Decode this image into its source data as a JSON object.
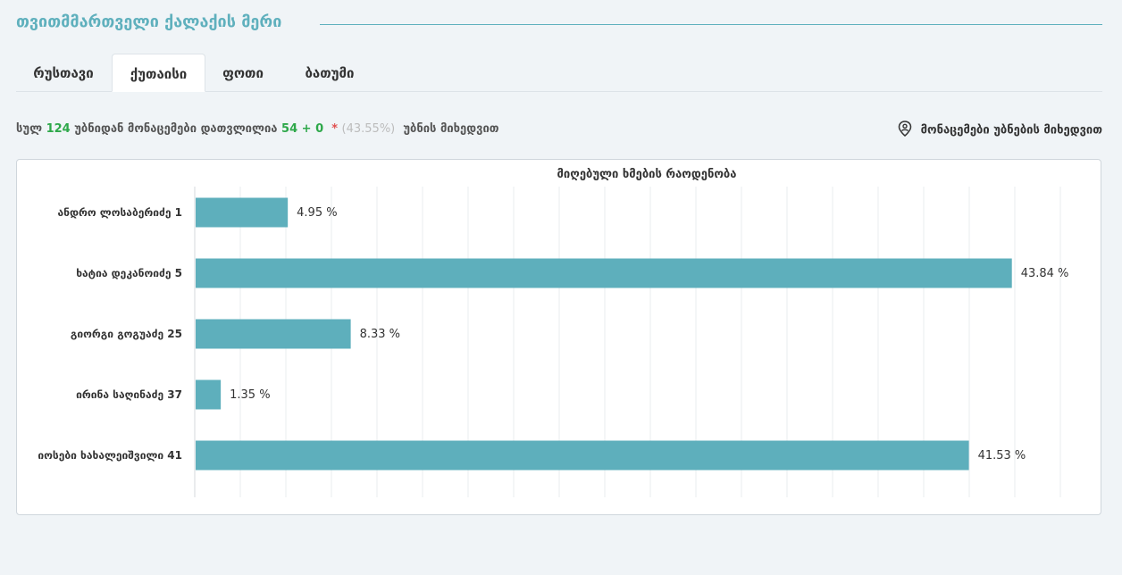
{
  "header": {
    "title": "თვითმმართველი ქალაქის მერი"
  },
  "tabs": [
    {
      "label": "რუსთავი",
      "active": false
    },
    {
      "label": "ქუთაისი",
      "active": true
    },
    {
      "label": "ფოთი",
      "active": false
    },
    {
      "label": "ბათუმი",
      "active": false
    }
  ],
  "stats": {
    "prefix": "სულ",
    "total": "124",
    "mid": "უბნიდან მონაცემები დათვლილია",
    "counted": "54 + 0",
    "star": "*",
    "percent": "(43.55%)",
    "suffix": "უბნის მიხედვით"
  },
  "by_district": {
    "label": "მონაცემები უბნების მიხედვით",
    "icon": "location-pin-icon"
  },
  "colors": {
    "accent": "#5fb0bd",
    "bar": "#5eafbc",
    "green": "#2ea84a",
    "red": "#e05050"
  },
  "chart_data": {
    "type": "bar",
    "orientation": "horizontal",
    "title": "მიღებული ხმების რაოდენობა",
    "categories": [
      "ანდრო ლოსაბერიძე 1",
      "ხატია დეკანოიძე 5",
      "გიორგი გოგუაძე 25",
      "ირინა საღინაძე 37",
      "იოსები ხახალეიშვილი 41"
    ],
    "values": [
      4.95,
      43.84,
      8.33,
      1.35,
      41.53
    ],
    "value_labels": [
      "4.95 %",
      "43.84 %",
      "8.33 %",
      "1.35 %",
      "41.53 %"
    ],
    "xlim": [
      0,
      47.5
    ],
    "grid": true
  }
}
